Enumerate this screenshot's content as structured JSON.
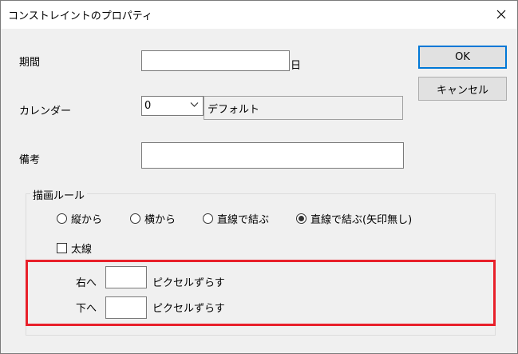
{
  "window": {
    "title": "コンストレイントのプロパティ"
  },
  "fields": {
    "period_label": "期間",
    "period_value": "",
    "period_unit": "日",
    "calendar_label": "カレンダー",
    "calendar_selected": "0",
    "calendar_name": "デフォルト",
    "note_label": "備考",
    "note_value": ""
  },
  "buttons": {
    "ok": "OK",
    "cancel": "キャンセル"
  },
  "draw_rule": {
    "title": "描画ルール",
    "options": [
      "縦から",
      "横から",
      "直線で結ぶ",
      "直線で結ぶ(矢印無し)"
    ],
    "selected_index": 3,
    "thick_line_label": "太線",
    "thick_line_checked": false,
    "shift_right_label": "右へ",
    "shift_right_value": "",
    "shift_down_label": "下へ",
    "shift_down_value": "",
    "shift_unit": "ピクセルずらす"
  },
  "colors": {
    "highlight": "#e8202a",
    "accent": "#0078d7"
  }
}
